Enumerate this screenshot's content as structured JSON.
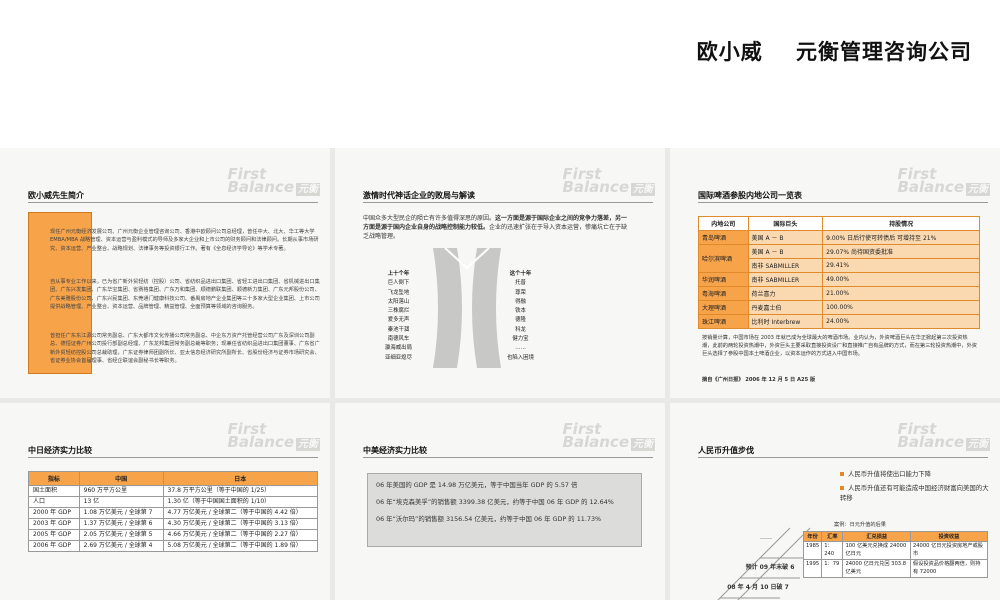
{
  "header": {
    "title": "欧小威    元衡管理咨询公司"
  },
  "watermark": {
    "line1": "First",
    "line2": "Balance",
    "badge": "元衡"
  },
  "slide1": {
    "title": "欧小威先生简介",
    "paragraphs": [
      "现任广州元衡经济发展公司、广州元衡企业管理咨询公司、香港中欧顾问公司总经理，曾任中大、北大、华工等大学 EMBA/MBA 战略管理、资本运营与盈利模式的导师及多家大企业和上市公司的财务顾问和法律顾问。长期从事市场研究、资本运营、产业整合、战略规划、法律事务等投资银行工作。著有《全息经济学导论》等学术专著。",
      "自从事专业工作以来，已为省广新外贸轻纺（控股）公司、省纺织品进出口集团、省轻工进出口集团、省机械进出口集团、广东兴发集团、广东华宝集团、省赛格集团、广东万和集团、顺德鹏联集团、顺德新力集团、广东元邦股份公司、广东美雅股份公司、广东兴民集团、东莞通门健康科技公司、番禺房地产企业集团等三十多家大型企业集团、上市公司提供战略管理、产业整合、资本运营、品牌管理、精益管理、全面预算等领域的咨询服务。",
      "曾担任广东东江源公司常务副总、广东大都市文化传播公司常务副总、中企东方资产托管经营公司广东及深圳公司副总、德恒证券广州公司投行部副总经理、广东龙邦集团常务副总裁等职务；现兼任省纺织品进出口集团董事、广东省广新外贸轻纺控股公司总裁助理，广东证券律师团副所长、亚太信息经济研究所副所长、省股份经济与证券市场研究会、省证券业协会首届理事、省经企联谊会副秘书长等职务。"
    ]
  },
  "slide2": {
    "title": "激情时代神话企业的败局与解读",
    "intro_normal": "中国众多大型民企的陨亡有许多值得深思的原因。",
    "intro_bold": "这一方面是源于国际企业之间的竞争力落差，另一方面是源于国内企业自身的战略控制能力较低。",
    "intro_tail": "企业的迅速扩张在于导入资本运营，惨痛坑亡在于缺乏战略管理。",
    "left_header": "上十个年",
    "left_items": [
      "巨人倒下",
      "飞龙坠地",
      "太阳落山",
      "三株腐烂",
      "爱多无声",
      "秦池干涸",
      "南德风车",
      "瀛海威出局",
      "亚细亚熄尽"
    ],
    "right_header": "这个十年",
    "right_items": [
      "托普",
      "尊荣",
      "得融",
      "铁本",
      "德隆",
      "科龙",
      "健力宝",
      "……",
      "也陷入困境"
    ]
  },
  "slide3": {
    "title": "国际啤酒参股内地公司一览表",
    "headers": [
      "内地公司",
      "国际巨头",
      "持股情况"
    ],
    "rows": [
      [
        "青岛啤酒",
        "美国 A － B",
        "9.00%  日后行使可转债后  可增持至 21%"
      ],
      [
        "哈尔滨啤酒",
        "美国 A － B",
        "29.07%  尚待国资委批准"
      ],
      [
        "",
        "南非 SABMILLER",
        "29.41%"
      ],
      [
        "华润啤酒",
        "南非 SABMILLER",
        "49.00%"
      ],
      [
        "粤海啤酒",
        "荷兰喜力",
        "21.00%"
      ],
      [
        "大理啤酒",
        "丹麦嘉士伯",
        "100.00%"
      ],
      [
        "珠江啤酒",
        "比利时 Interbrew",
        "24.00%"
      ]
    ],
    "note": "按销量计算，中国市场在 2003 年就已成为全球最大的啤酒市场。业内认为，外资啤酒巨头在华正掀起第三次投资热潮，此前的两轮投资热潮中，外资巨头主要采取直接投资设厂和直接推广自有品牌的方式，而在第三轮投资热潮中，外资巨头选择了参股中国本土啤酒企业，以资本运作的方式进入中国市场。",
    "source": "摘自《广州日报》 2006 年 12 月 5 日 A25 版"
  },
  "slide4": {
    "title": "中日经济实力比较",
    "headers": [
      "指标",
      "中国",
      "日本"
    ],
    "rows": [
      [
        "国土面积",
        "960 万平方公里",
        "37.8 万平方公里（等于中国的 1/25）"
      ],
      [
        "人口",
        "13 亿",
        "1.30 亿（等于中国国土面积的 1/10）"
      ],
      [
        "2000 年 GDP",
        "1.08 万亿美元 / 全球第 7",
        "4.77 万亿美元 / 全球第二（等于中国的 4.42 倍）"
      ],
      [
        "2003 年 GDP",
        "1.37 万亿美元 / 全球第 6",
        "4.30 万亿美元 / 全球第二（等于中国的 3.13 倍）"
      ],
      [
        "2005 年 GDP",
        "2.05 万亿美元 / 全球第 5",
        "4.66 万亿美元 / 全球第二（等于中国的 2.27 倍）"
      ],
      [
        "2006 年 GDP",
        "2.69 万亿美元 / 全球第 4",
        "5.08 万亿美元 / 全球第二（等于中国的 1.89 倍）"
      ]
    ]
  },
  "slide5": {
    "title": "中美经济实力比较",
    "lines": [
      "06 年美国的 GDP 是 14.98 万亿美元，等于中国当年 GDP 的 5.57 倍",
      "06 年“埃克森美孚”的销售额 3399.38 亿美元，约等于中国 06 年 GDP 的 12.64%",
      "06 年“沃尔玛”的销售额 3156.54 亿美元，约等于中国 06 年 GDP 的 11.73%"
    ]
  },
  "slide6": {
    "title": "人民币升值步伐",
    "bullets": [
      "人民币升值将使出口能力下降",
      "人民币升值还有可能造成中国经济财富向美国的大转移"
    ],
    "ladder_labels": [
      "……",
      "预计 09 年末破 6",
      "08 年 4 月 10 日破 7"
    ],
    "table_caption": "案例：日元升值的后果",
    "headers": [
      "年份",
      "汇率",
      "汇兑损益",
      "投资收益"
    ],
    "rows": [
      [
        "1985",
        "1：240",
        "100 亿美元兑换成 24000 亿日元",
        "24000 亿日元投资房地产或股市"
      ],
      [
        "1995",
        "1：79",
        "24000 亿日元兑回 303.8 亿美元",
        "假设投资品价格翻两倍，则持有 72000"
      ]
    ]
  }
}
